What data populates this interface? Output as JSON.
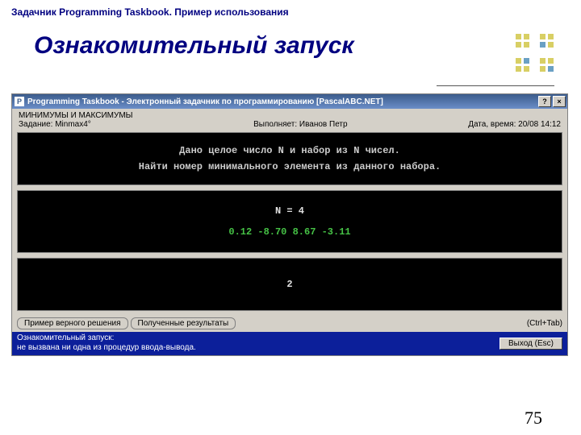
{
  "slide": {
    "header": "Задачник Programming Taskbook. Пример использования",
    "title": "Ознакомительный запуск",
    "page_number": "75"
  },
  "window": {
    "titlebar": {
      "icon_letter": "P",
      "text": "Programming Taskbook - Электронный задачник по программированию [PascalABC.NET]",
      "help": "?",
      "close": "×"
    },
    "info": {
      "topic": "МИНИМУМЫ И МАКСИМУМЫ",
      "task": "Задание: Minmax4°",
      "performer": "Выполняет: Иванов Петр",
      "datetime": "Дата, время: 20/08 14:12"
    },
    "task_text": {
      "line1": "Дано целое число N и набор из N чисел.",
      "line2": "Найти номер минимального элемента из данного набора."
    },
    "data_panel": {
      "n_line": "N = 4",
      "values": "0.12  -8.70   8.67  -3.11"
    },
    "result_panel": {
      "value": "2"
    },
    "bottom": {
      "tab1": "Пример верного решения",
      "tab2": "Полученные результаты",
      "shortcut": "(Ctrl+Tab)"
    },
    "status": {
      "line1": "Ознакомительный запуск:",
      "line2": "  не вызвана ни одна из процедур ввода-вывода.",
      "exit": "Выход (Esc)"
    }
  }
}
